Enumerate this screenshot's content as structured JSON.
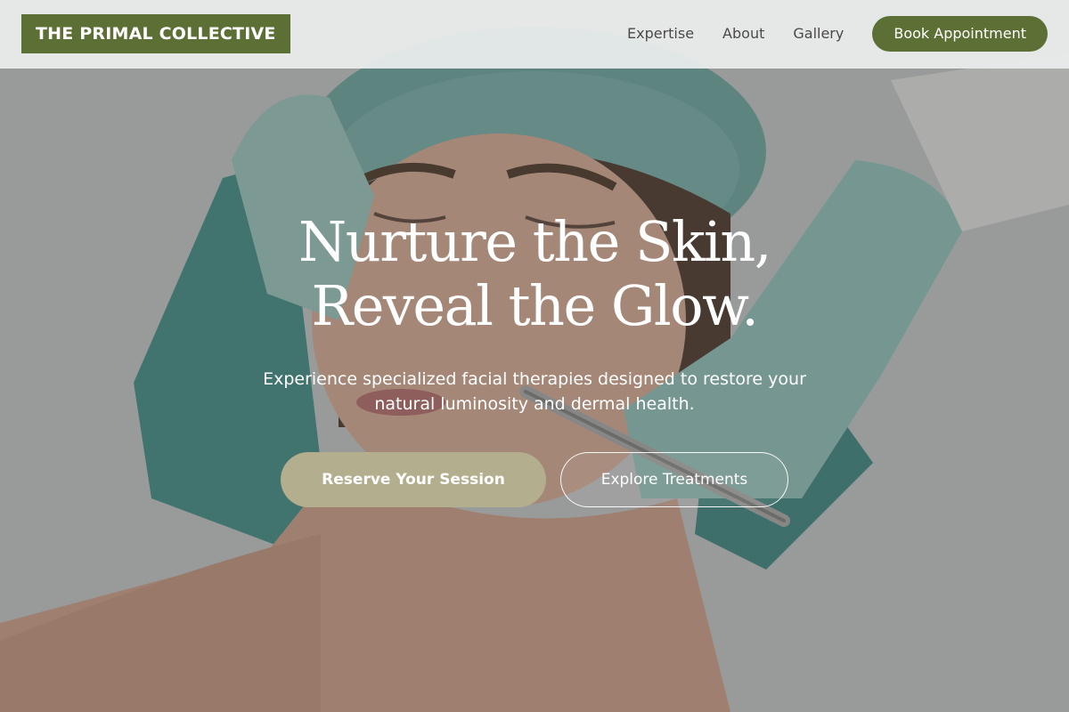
{
  "header": {
    "logo": "THE PRIMAL COLLECTIVE",
    "nav": [
      {
        "label": "Expertise"
      },
      {
        "label": "About"
      },
      {
        "label": "Gallery"
      }
    ],
    "cta_label": "Book Appointment"
  },
  "hero": {
    "title_line1": "Nurture the Skin,",
    "title_line2": "Reveal the Glow.",
    "subtitle": "Experience specialized facial therapies designed to restore your natural luminosity and dermal health.",
    "primary_cta": "Reserve Your Session",
    "secondary_cta": "Explore Treatments",
    "background_image": "facial-treatment-photo"
  },
  "colors": {
    "brand_green": "#5c7035",
    "accent_sand": "#b3ae8d",
    "header_bg": "#eceeee",
    "text_light": "#ffffff"
  }
}
